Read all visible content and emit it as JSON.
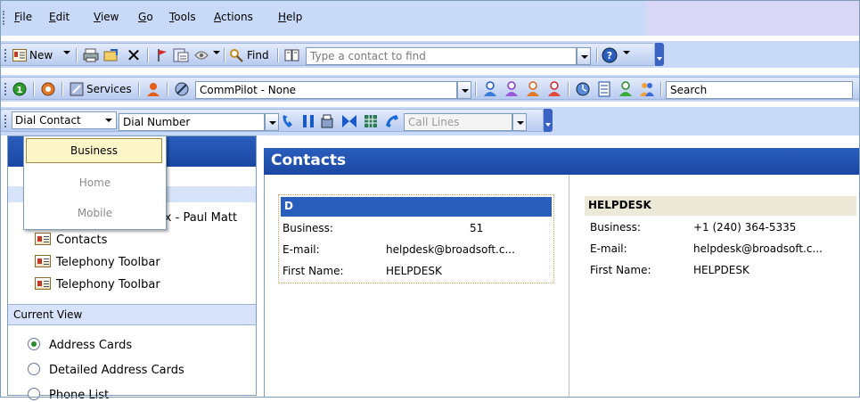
{
  "menubar": {
    "items": [
      {
        "label": "File",
        "underline": "F",
        "rest": "ile"
      },
      {
        "label": "Edit",
        "underline": "E",
        "rest": "dit"
      },
      {
        "label": "View",
        "underline": "V",
        "rest": "iew"
      },
      {
        "label": "Go",
        "underline": "G",
        "rest": "o"
      },
      {
        "label": "Tools",
        "underline": "T",
        "rest": "ools"
      },
      {
        "label": "Actions",
        "underline": "A",
        "rest": "ctions"
      },
      {
        "label": "Help",
        "underline": "H",
        "rest": "elp"
      }
    ]
  },
  "standard_toolbar": {
    "new_label": "New",
    "find_label": "Find",
    "contact_search_placeholder": "Type a contact to find"
  },
  "commpilot_toolbar": {
    "services_label": "Services",
    "status_value": "CommPilot - None",
    "search_label": "Search"
  },
  "telephony_toolbar": {
    "dial_contact_label": "Dial Contact",
    "dial_number_value": "Dial Number",
    "call_lines_value": "Call Lines"
  },
  "dial_menu": {
    "options": [
      "Business",
      "Home",
      "Mobile"
    ],
    "selected": "Business"
  },
  "navigation": {
    "partial_folder": "box - Paul Matt",
    "folders": [
      "Contacts",
      "Telephony Toolbar",
      "Telephony Toolbar"
    ],
    "current_view_heading": "Current View",
    "views": [
      "Address Cards",
      "Detailed Address Cards",
      "Phone List"
    ],
    "selected_view": "Address Cards"
  },
  "contacts": {
    "title": "Contacts",
    "cards": [
      {
        "name": "D",
        "fields": [
          {
            "label": "Business:",
            "value": "51"
          },
          {
            "label": "E-mail:",
            "value": "helpdesk@broadsoft.c..."
          },
          {
            "label": "First Name:",
            "value": "HELPDESK"
          }
        ]
      },
      {
        "name": "HELPDESK",
        "fields": [
          {
            "label": "Business:",
            "value": "+1 (240) 364-5335"
          },
          {
            "label": "E-mail:",
            "value": "helpdesk@broadsoft.c..."
          },
          {
            "label": "First Name:",
            "value": "HELPDESK"
          }
        ]
      }
    ]
  },
  "colors": {
    "header_blue": "#1b47a3",
    "toolbar_blue": "#c9daf8",
    "selection_yellow": "#fdf6c8"
  }
}
